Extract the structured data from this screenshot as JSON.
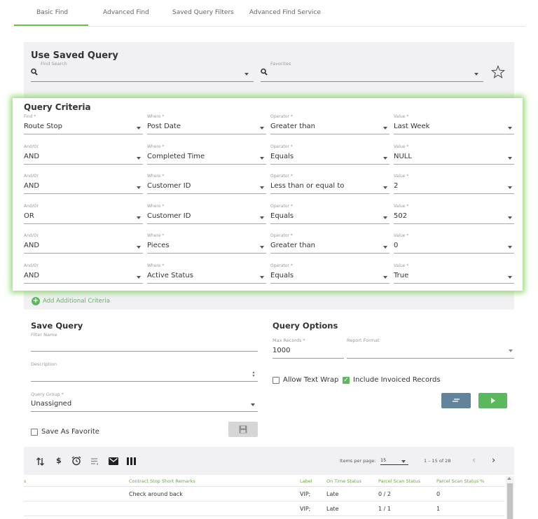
{
  "tabs": [
    "Basic Find",
    "Advanced Find",
    "Saved Query Filters",
    "Advanced Find Service"
  ],
  "saved_query": {
    "title": "Use Saved Query",
    "find_search_label": "Find Search",
    "find_search_value": "",
    "favorites_label": "Favorites",
    "favorites_value": ""
  },
  "query_criteria": {
    "title": "Query Criteria",
    "rows": [
      {
        "first_label": "Find *",
        "first_value": "Route Stop",
        "where_label": "Where *",
        "where_value": "Post Date",
        "operator_label": "Operator *",
        "operator_value": "Greater than",
        "value_label": "Value *",
        "value_value": "Last Week"
      },
      {
        "first_label": "And/Or",
        "first_value": "AND",
        "where_label": "Where *",
        "where_value": "Completed Time",
        "operator_label": "Operator *",
        "operator_value": "Equals",
        "value_label": "Value *",
        "value_value": "NULL"
      },
      {
        "first_label": "And/Or",
        "first_value": "AND",
        "where_label": "Where *",
        "where_value": "Customer ID",
        "operator_label": "Operator *",
        "operator_value": "Less than or equal to",
        "value_label": "Value *",
        "value_value": "2"
      },
      {
        "first_label": "And/Or",
        "first_value": "OR",
        "where_label": "Where *",
        "where_value": "Customer ID",
        "operator_label": "Operator *",
        "operator_value": "Equals",
        "value_label": "Value *",
        "value_value": "502"
      },
      {
        "first_label": "And/Or",
        "first_value": "AND",
        "where_label": "Where *",
        "where_value": "Pieces",
        "operator_label": "Operator *",
        "operator_value": "Greater than",
        "value_label": "Value *",
        "value_value": "0"
      },
      {
        "first_label": "And/Or",
        "first_value": "AND",
        "where_label": "Where *",
        "where_value": "Active Status",
        "operator_label": "Operator *",
        "operator_value": "Equals",
        "value_label": "Value *",
        "value_value": "True"
      }
    ],
    "add_label": "Add Additional Criteria"
  },
  "save_query": {
    "title": "Save Query",
    "filter_name_label": "Filter Name",
    "filter_name_value": "",
    "description_label": "Description",
    "description_value": "",
    "query_group_label": "Query Group *",
    "query_group_value": "Unassigned",
    "favorite_label": "Save As Favorite",
    "favorite_checked": false
  },
  "query_options": {
    "title": "Query Options",
    "max_records_label": "Max Records *",
    "max_records_value": "1000",
    "report_format_label": "Report Format",
    "report_format_value": "",
    "allow_wrap_label": "Allow Text Wrap",
    "allow_wrap_checked": false,
    "include_invoiced_label": "Include Invoiced Records",
    "include_invoiced_checked": true
  },
  "toolbar": {
    "icons": [
      "sort-icon",
      "dollar-icon",
      "alarm-clock-icon",
      "list-icon",
      "mail-icon",
      "columns-icon"
    ],
    "items_per_page_label": "Items per page:",
    "items_per_page_value": "15",
    "range_text": "1 – 15 of 28"
  },
  "table": {
    "headers": [
      "s",
      "Contract Stop Short Remarks",
      "Label",
      "On Time Status",
      "Parcel Scan Status",
      "Parcel Scan Status %"
    ],
    "rows": [
      {
        "remarks": "Check around back",
        "label": "VIP;",
        "on_time": "Late",
        "parcel_scan": "0 / 2",
        "parcel_pct": "0"
      },
      {
        "remarks": "",
        "label": "VIP;",
        "on_time": "Late",
        "parcel_scan": "1 / 1",
        "parcel_pct": "1"
      }
    ]
  },
  "colors": {
    "accent_green": "#5cb85c",
    "panel_gray": "#f1f0f3",
    "report_button": "#62849b"
  }
}
